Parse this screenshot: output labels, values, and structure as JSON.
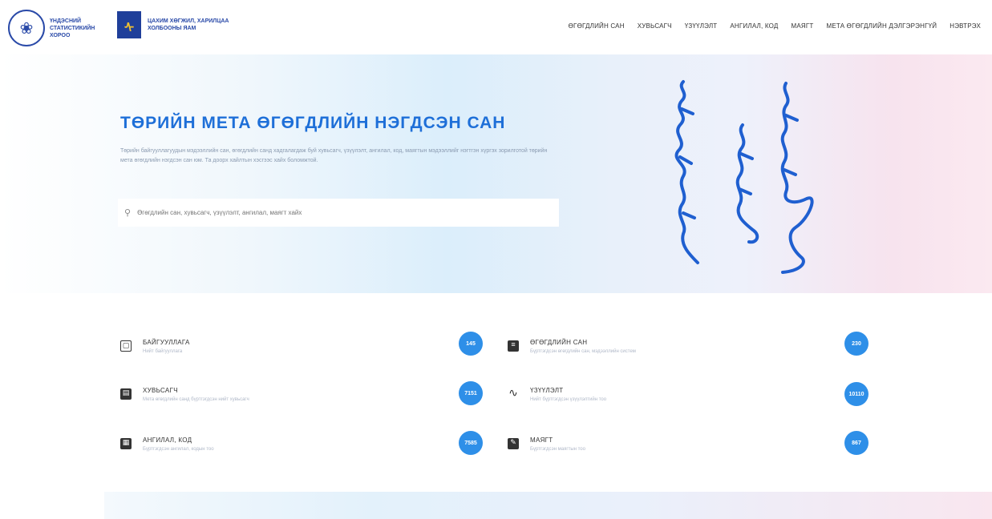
{
  "header": {
    "logo1_text": "ҮНДЭСНИЙ СТАТИСТИКИЙН ХОРОО",
    "logo2_text": "ЦАХИМ ХӨГЖИЛ, ХАРИЛЦАА ХОЛБООНЫ ЯАМ",
    "nav": [
      "ӨГӨГДЛИЙН САН",
      "ХУВЬСАГЧ",
      "ҮЗҮҮЛЭЛТ",
      "АНГИЛАЛ, КОД",
      "МАЯГТ",
      "МЕТА ӨГӨГДЛИЙН ДЭЛГЭРЭНГҮЙ",
      "НЭВТРЭХ"
    ]
  },
  "hero": {
    "title": "ТӨРИЙН МЕТА ӨГӨГДЛИЙН НЭГДСЭН САН",
    "description": "Төрийн байгууллагуудын мэдээллийн сан, өгөгдлийн санд хадгалагдаж буй хувьсагч, үзүүлэлт, ангилал, код, маягтын мэдээллийг нэгтгэн хүргэх зорилготой төрийн мета өгөгдлийн нэгдсэн сан юм. Та доорх хайлтын хэсгээс хайх боломжтой.",
    "search_placeholder": "Өгөгдлийн сан, хувьсагч, үзүүлэлт, ангилал, маягт хайх"
  },
  "cards": [
    {
      "title": "БАЙГУУЛЛАГА",
      "subtitle": "Нийт байгууллага",
      "count": "145",
      "icon": "building-icon"
    },
    {
      "title": "ӨГӨГДЛИЙН САН",
      "subtitle": "Бүртгэгдсэн өгөгдлийн сан, мэдээллийн систем",
      "count": "230",
      "icon": "database-icon"
    },
    {
      "title": "ХУВЬСАГЧ",
      "subtitle": "Мета өгөгдлийн санд бүртгэгдсэн нийт хувьсагч",
      "count": "7151",
      "icon": "variable-icon"
    },
    {
      "title": "ҮЗҮҮЛЭЛТ",
      "subtitle": "Нийт бүртгэгдсэн үзүүлэлтийн тоо",
      "count": "10110",
      "icon": "indicator-icon"
    },
    {
      "title": "АНГИЛАЛ, КОД",
      "subtitle": "Бүртгэгдсэн ангилал, кодын тоо",
      "count": "7585",
      "icon": "classification-icon"
    },
    {
      "title": "МАЯГТ",
      "subtitle": "Бүртгэгдсэн маягтын тоо",
      "count": "867",
      "icon": "form-icon"
    }
  ],
  "colors": {
    "accent": "#1e6fd8",
    "badge": "#2e8fe8",
    "script": "#1f5fd0"
  }
}
